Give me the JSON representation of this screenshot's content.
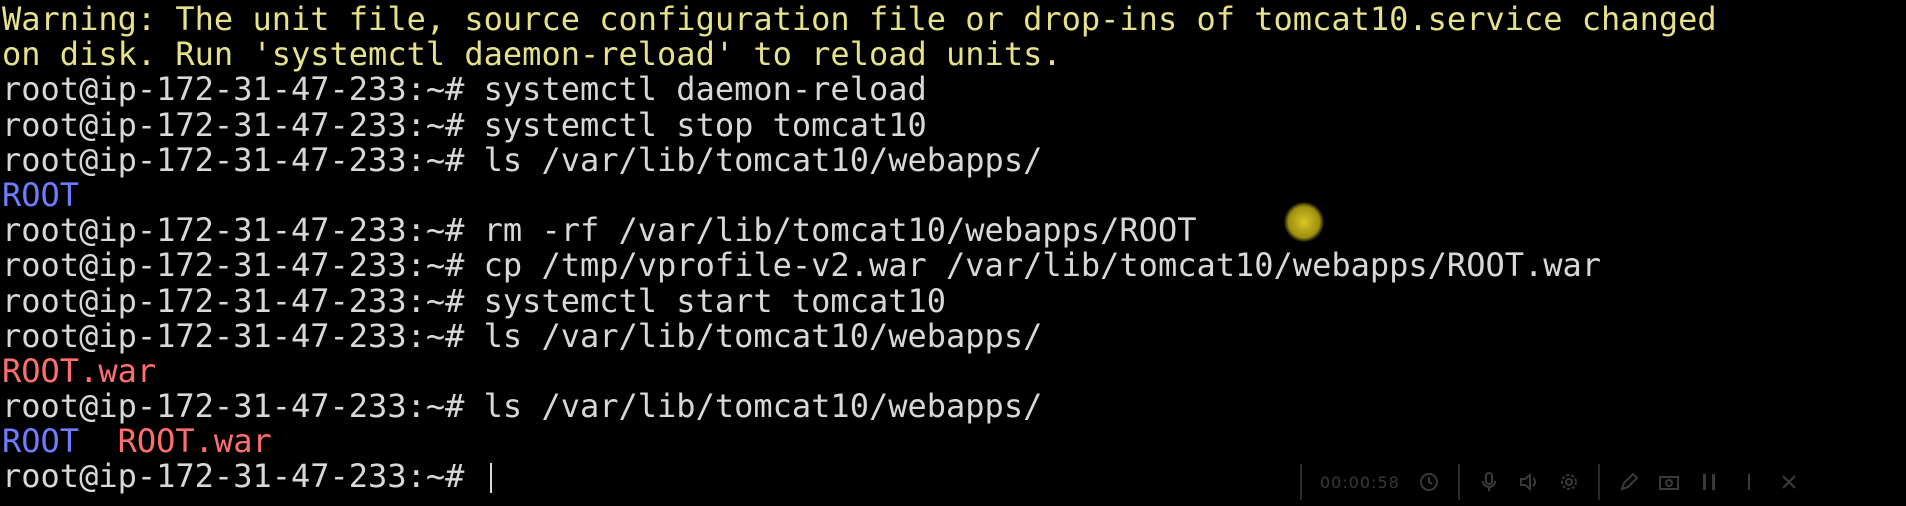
{
  "terminal": {
    "prompt": "root@ip-172-31-47-233:~#",
    "lines": [
      {
        "type": "warning",
        "text": "Warning: The unit file, source configuration file or drop-ins of tomcat10.service changed"
      },
      {
        "type": "warning",
        "text": "on disk. Run 'systemctl daemon-reload' to reload units."
      },
      {
        "type": "command",
        "cmd": " systemctl daemon-reload"
      },
      {
        "type": "command",
        "cmd": " systemctl stop tomcat10"
      },
      {
        "type": "command",
        "cmd": " ls /var/lib/tomcat10/webapps/"
      },
      {
        "type": "output",
        "parts": [
          {
            "text": "ROOT",
            "color": "blue"
          }
        ]
      },
      {
        "type": "command",
        "cmd": " rm -rf /var/lib/tomcat10/webapps/ROOT"
      },
      {
        "type": "command",
        "cmd": " cp /tmp/vprofile-v2.war /var/lib/tomcat10/webapps/ROOT.war"
      },
      {
        "type": "command",
        "cmd": " systemctl start tomcat10"
      },
      {
        "type": "command",
        "cmd": " ls /var/lib/tomcat10/webapps/"
      },
      {
        "type": "output",
        "parts": [
          {
            "text": "ROOT.war",
            "color": "red"
          }
        ]
      },
      {
        "type": "command",
        "cmd": " ls /var/lib/tomcat10/webapps/"
      },
      {
        "type": "output",
        "parts": [
          {
            "text": "ROOT",
            "color": "blue"
          },
          {
            "text": "  ",
            "color": "none"
          },
          {
            "text": "ROOT.war",
            "color": "red"
          }
        ]
      },
      {
        "type": "prompt-cursor",
        "cmd": " "
      }
    ],
    "colors": {
      "background": "#000000",
      "text": "#d8d8d8",
      "warning": "#e6e28a",
      "directory": "#6f7cff",
      "archive": "#ff6e6e",
      "pointer": "#d6c21c"
    }
  },
  "recorder_toolbar": {
    "time": "00:00:58",
    "icons": [
      "clock-icon",
      "microphone-icon",
      "speaker-icon",
      "settings-icon",
      "pen-icon",
      "camera-icon",
      "pause-icon",
      "stop-icon",
      "close-icon"
    ]
  }
}
